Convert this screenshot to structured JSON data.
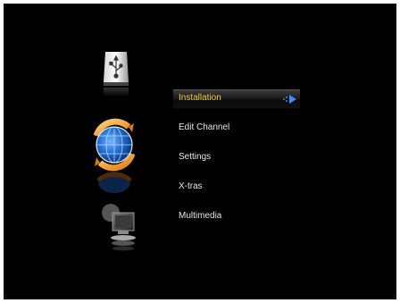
{
  "menu": {
    "items": [
      {
        "label": "Installation",
        "selected": true
      },
      {
        "label": "Edit Channel",
        "selected": false
      },
      {
        "label": "Settings",
        "selected": false
      },
      {
        "label": "X-tras",
        "selected": false
      },
      {
        "label": "Multimedia",
        "selected": false
      }
    ]
  },
  "icons": [
    "usb-drive-icon",
    "globe-sync-icon",
    "multimedia-monitor-icon"
  ],
  "colors": {
    "background": "#000000",
    "selected_text": "#f0d040",
    "text": "#e8e8e8",
    "arrow": "#3a8cff"
  }
}
